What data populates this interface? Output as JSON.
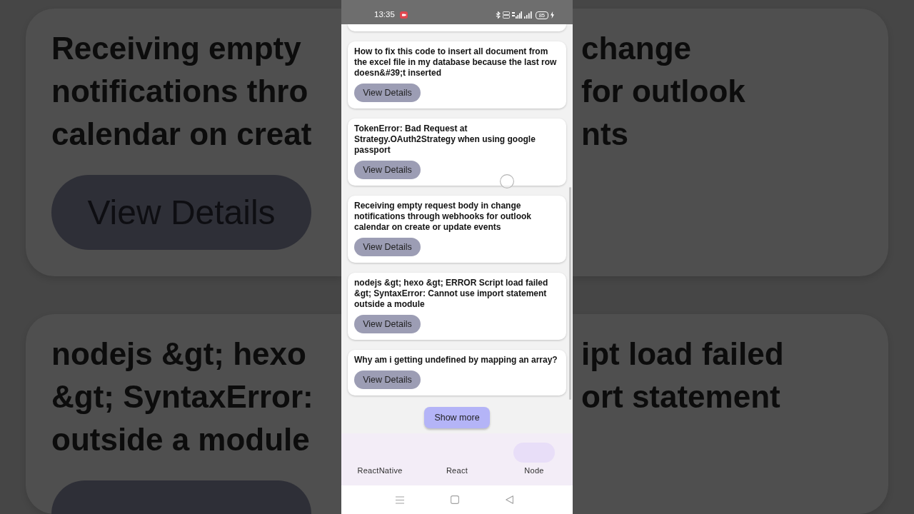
{
  "backdrop": {
    "left_cards": [
      {
        "lines": [
          "Receiving empty",
          "notifications thro",
          "calendar on creat"
        ],
        "button": "View Details"
      },
      {
        "lines": [
          "nodejs &gt; hexo",
          "&gt; SyntaxError:",
          "outside a module"
        ],
        "button_partial": true
      }
    ],
    "right_cards": [
      {
        "lines": [
          "change",
          "for outlook",
          "nts"
        ]
      },
      {
        "lines": [
          "ipt load failed",
          "ort statement"
        ]
      }
    ]
  },
  "status_bar": {
    "time": "13:35",
    "battery": "85"
  },
  "question_list": {
    "partial_card_above": true,
    "items": [
      {
        "title": "How to fix this code to insert all document from the excel file in my database because the last row doesn&#39;t inserted",
        "button": "View Details"
      },
      {
        "title": "TokenError: Bad Request at Strategy.OAuth2Strategy when using google passport",
        "button": "View Details"
      },
      {
        "title": "Receiving empty request body in change notifications through webhooks for outlook calendar on create or update events",
        "button": "View Details"
      },
      {
        "title": "nodejs &gt; hexo &gt; ERROR Script load failed &gt; SyntaxError: Cannot use import statement outside a module",
        "button": "View Details"
      },
      {
        "title": "Why am i getting undefined by mapping an array?",
        "button": "View Details"
      }
    ]
  },
  "show_more": "Show more",
  "bottom_nav": [
    {
      "label": "ReactNative",
      "selected": false
    },
    {
      "label": "React",
      "selected": false
    },
    {
      "label": "Node",
      "selected": true
    }
  ]
}
